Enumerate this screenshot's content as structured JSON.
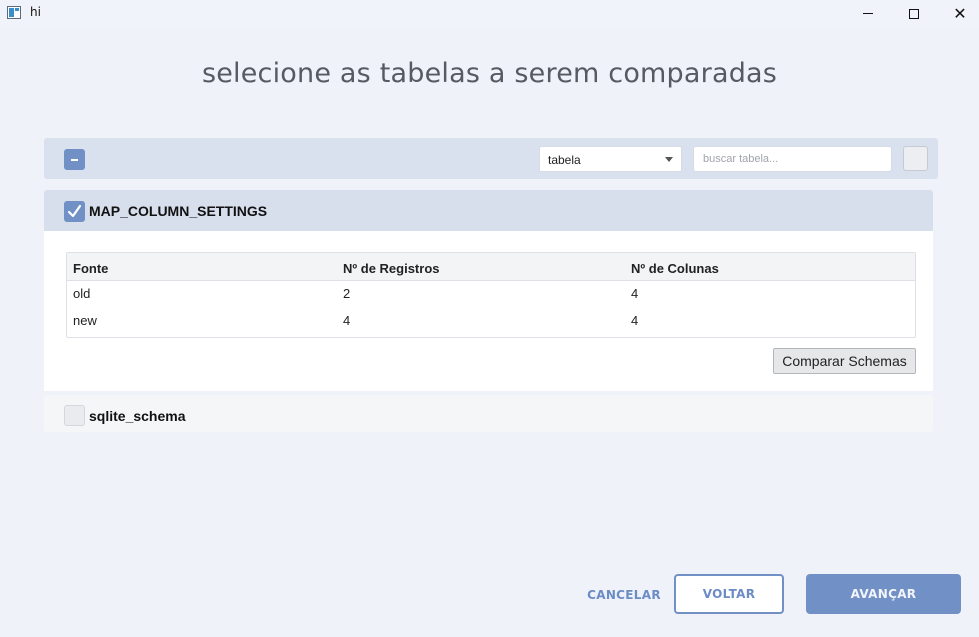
{
  "window": {
    "title": "hi",
    "minimize_icon": "minimize-icon",
    "maximize_icon": "maximize-icon",
    "close_icon": "close-icon"
  },
  "page": {
    "title": "selecione as tabelas a serem comparadas"
  },
  "toolbar": {
    "collapse_icon": "minus-icon",
    "column_select": {
      "selected": "tabela"
    },
    "search": {
      "placeholder": "buscar tabela...",
      "value": ""
    }
  },
  "tables": [
    {
      "name": "MAP_COLUMN_SETTINGS",
      "checked": true,
      "expanded": true,
      "columns": [
        "Fonte",
        "Nº de Registros",
        "Nº de Colunas"
      ],
      "rows": [
        [
          "old",
          "2",
          "4"
        ],
        [
          "new",
          "4",
          "4"
        ]
      ],
      "compare_button": "Comparar Schemas"
    },
    {
      "name": "sqlite_schema",
      "checked": false,
      "expanded": false
    }
  ],
  "footer": {
    "cancel": "CANCELAR",
    "back": "VOLTAR",
    "next": "AVANÇAR"
  },
  "colors": {
    "accent": "#7191c6",
    "background": "#eff2f9",
    "panel_header": "#d7deec"
  }
}
